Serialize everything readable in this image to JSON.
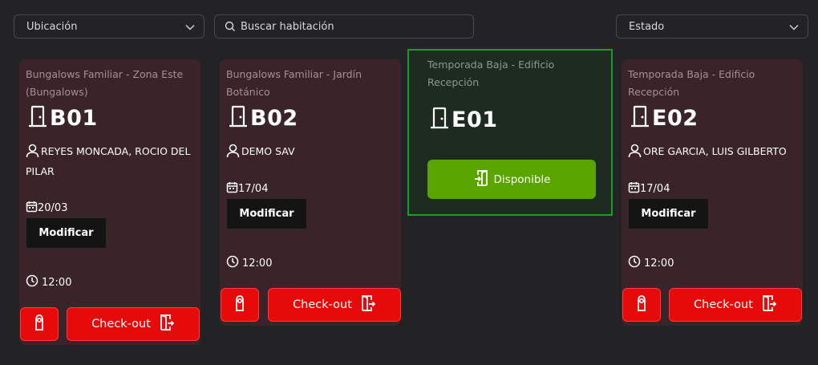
{
  "filters": {
    "location": {
      "label": "Ubicación",
      "icon": "chevron-down-icon"
    },
    "search": {
      "placeholder": "Buscar habitación",
      "icon": "search-icon"
    },
    "status": {
      "label": "Estado",
      "icon": "chevron-down-icon"
    }
  },
  "colors": {
    "accent_red": "#e60a0a",
    "available_green": "#5aa400",
    "available_border": "#1f9a24",
    "card_occupied_bg": "#3a2429",
    "card_available_bg": "#1d2b20",
    "page_bg": "#232325"
  },
  "rooms": [
    {
      "location": "Bungalows Familiar - Zona Este (Bungalows)",
      "code": "B01",
      "guest": "REYES MONCADA, ROCIO DEL PILAR",
      "date": "20/03",
      "modify_label": "Modificar",
      "time": "12:00",
      "checkout_label": "Check-out",
      "status": "occupied"
    },
    {
      "location": "Bungalows Familiar - Jardín Botánico",
      "code": "B02",
      "guest": "DEMO SAV",
      "date": "17/04",
      "modify_label": "Modificar",
      "time": "12:00",
      "checkout_label": "Check-out",
      "status": "occupied"
    },
    {
      "location": "Temporada Baja - Edificio Recepción",
      "code": "E01",
      "available_label": "Disponible",
      "status": "available"
    },
    {
      "location": "Temporada Baja - Edificio Recepción",
      "code": "E02",
      "guest": "ORE GARCIA, LUIS GILBERTO",
      "date": "17/04",
      "modify_label": "Modificar",
      "time": "12:00",
      "checkout_label": "Check-out",
      "status": "occupied"
    }
  ]
}
